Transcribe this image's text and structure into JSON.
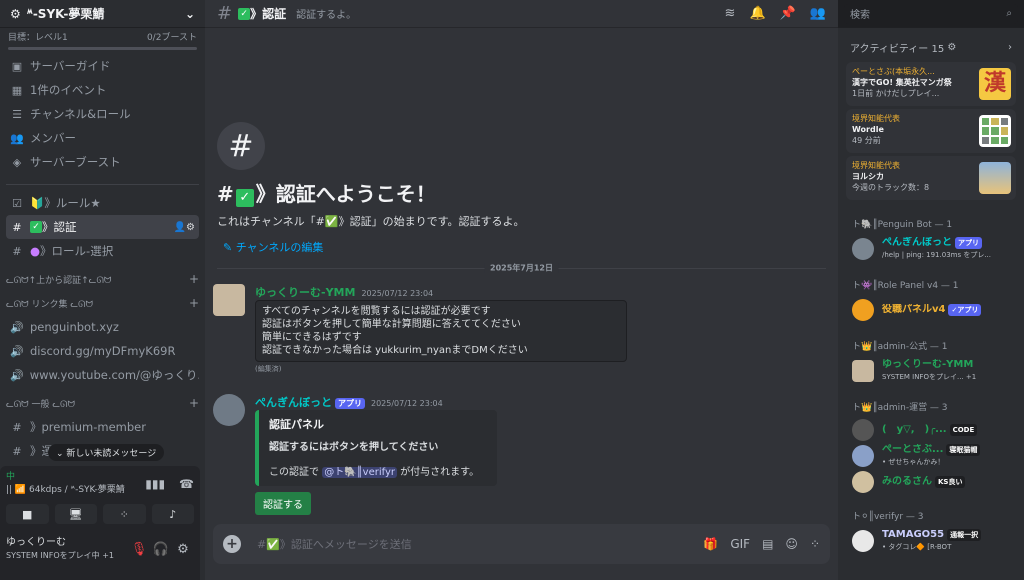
{
  "server": {
    "name": "ᔿ-SYK-夢栗鯖",
    "boost_label": "目標：レベル1",
    "boost_count": "0/2ブースト"
  },
  "nav": [
    {
      "label": "サーバーガイド",
      "icon": "guide-icon"
    },
    {
      "label": "1件のイベント",
      "icon": "calendar-icon"
    },
    {
      "label": "チャンネル&ロール",
      "icon": "channels-roles-icon"
    },
    {
      "label": "メンバー",
      "icon": "members-icon"
    },
    {
      "label": "サーバーブースト",
      "icon": "boost-icon"
    }
  ],
  "channels": {
    "rules": "🔰》ルール★",
    "verify": "》認証",
    "role_select": "》ロール-選択",
    "cat_verify": "ᓚᘏᗢ↑上から認証↑ᓚᘏᗢ",
    "cat_links": "ᓚᘏᗢ リンク集 ᓚᘏᗢ",
    "link1": "penguinbot.xyz",
    "link2": "discord.gg/myDFmyK69R",
    "link3": "www.youtube.com/@ゆっくり...",
    "cat_general": "ᓚᘏᗢ 一般 ᓚᘏᗢ",
    "premium": "》premium-member",
    "unseen": "》運営への質問箱"
  },
  "new_messages": "新しい未読メッセージ",
  "voice": {
    "status": "中",
    "sub": "|| 📶 64kdps / ᔿ-SYK-夢栗鯖"
  },
  "user": {
    "name": "ゆっくりーむ",
    "status": "SYSTEM INFOをプレイ中 +1"
  },
  "topbar": {
    "channel": "》認証",
    "topic": "認証するよ。"
  },
  "welcome": {
    "title_prefix": "#",
    "title": "》認証へようこそ！",
    "desc": "これはチャンネル「#✅》認証」の始まりです。認証するよ。",
    "edit": "チャンネルの編集"
  },
  "date_divider": "2025年7月12日",
  "msg1": {
    "author": "ゆっくりーむ-YMM",
    "time": "2025/07/12 23:04",
    "lines": [
      "すべてのチャンネルを閲覧するには認証が必要です",
      "認証はボタンを押して簡単な計算問題に答えててください",
      "簡単にできるはずです",
      "認証できなかった場合は yukkurim_nyanまでDMください"
    ],
    "edited": "(編集済)"
  },
  "msg2": {
    "author": "ぺんぎんぼっと",
    "badge": "アプリ",
    "time": "2025/07/12 23:04",
    "embed_title": "認証パネル",
    "embed_desc": "認証するにはボタンを押してください",
    "embed_footer_pre": "この認証で",
    "embed_mention": "@ト🐘║verifyr",
    "embed_footer_post": "が付与されます。",
    "button": "認証する"
  },
  "composer": {
    "placeholder": "#✅》認証へメッセージを送信"
  },
  "search": {
    "placeholder": "検索"
  },
  "activity": {
    "header": "アクティビティー 15",
    "cards": [
      {
        "user": "ぺーとさぶ(本垢永久...",
        "game": "漢字でGO! 集英社マンガ祭",
        "sub": "1日前 かけだしプレイ...",
        "thumb": "漢"
      },
      {
        "user": "境界知能代表",
        "game": "Wordle",
        "sub": "49 分前",
        "thumb": ""
      },
      {
        "user": "境界知能代表",
        "game": "ヨルシカ",
        "sub": "今週のトラック数：8",
        "thumb": ""
      }
    ]
  },
  "groups": [
    {
      "header": "ト🐘║Penguin Bot — 1",
      "members": [
        {
          "name": "ぺんぎんぼっと",
          "tag": "アプリ",
          "status": "/help | ping: 191.03ms をプレ..."
        }
      ]
    },
    {
      "header": "ト👾║Role Panel v4 — 1",
      "members": [
        {
          "name": "役職パネルv4",
          "tag": "✓アプリ",
          "status": ""
        }
      ]
    },
    {
      "header": "ト👑║admin-公式 — 1",
      "members": [
        {
          "name": "ゆっくりーむ-YMM",
          "tag": "",
          "status": "SYSTEM INFOをプレイ... +1"
        }
      ]
    },
    {
      "header": "ト👑║admin-運営 — 3",
      "members": [
        {
          "name": "(￣y▽,￣)╭...",
          "tag": "CODE",
          "status": ""
        },
        {
          "name": "ぺーとさぶ...",
          "tag": "寝眠猫帽",
          "status": "• ぜせちゃんかみ！"
        },
        {
          "name": "みのるさん",
          "tag": "KS良い",
          "status": ""
        }
      ]
    },
    {
      "header": "ト⚪║verifyr — 3",
      "members": [
        {
          "name": "TAMAGO55",
          "tag": "通報一択",
          "status": "• タグコレ🔶 [R-BOT"
        }
      ]
    }
  ]
}
